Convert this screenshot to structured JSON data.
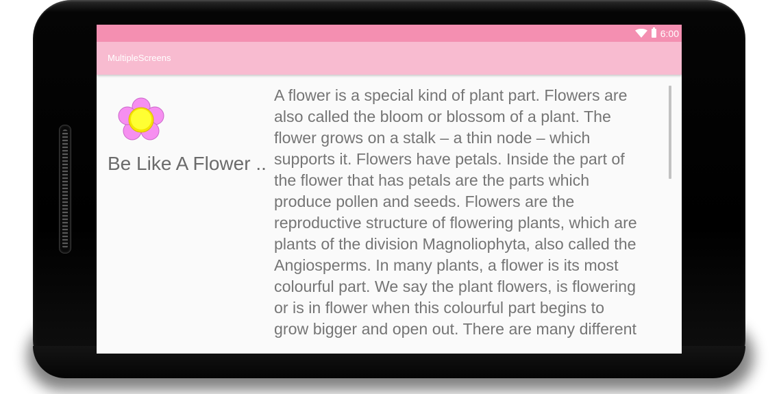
{
  "status_bar": {
    "time": "6:00",
    "color": "#f48fb1",
    "icons": [
      "wifi-icon",
      "battery-icon"
    ]
  },
  "app_bar": {
    "title": "MultipleScreens",
    "color": "#f8bbd0"
  },
  "content": {
    "heading": "Be Like A Flower ..",
    "image": "flower-icon",
    "body_lines": [
      "A flower is a special kind of plant part. Flowers are",
      "also called the bloom or blossom of a plant. The",
      "flower grows on a stalk – a thin node – which",
      "supports it. Flowers have petals. Inside the part of",
      "the flower that has petals are the parts which",
      "produce pollen and seeds. Flowers are the",
      "reproductive structure of flowering plants, which are",
      "plants of the division Magnoliophyta, also called the",
      "Angiosperms. In many plants, a flower is its most",
      "colourful part. We say the plant flowers, is flowering",
      "or is in flower when this colourful part begins to",
      "grow bigger and open out. There are many different"
    ]
  }
}
